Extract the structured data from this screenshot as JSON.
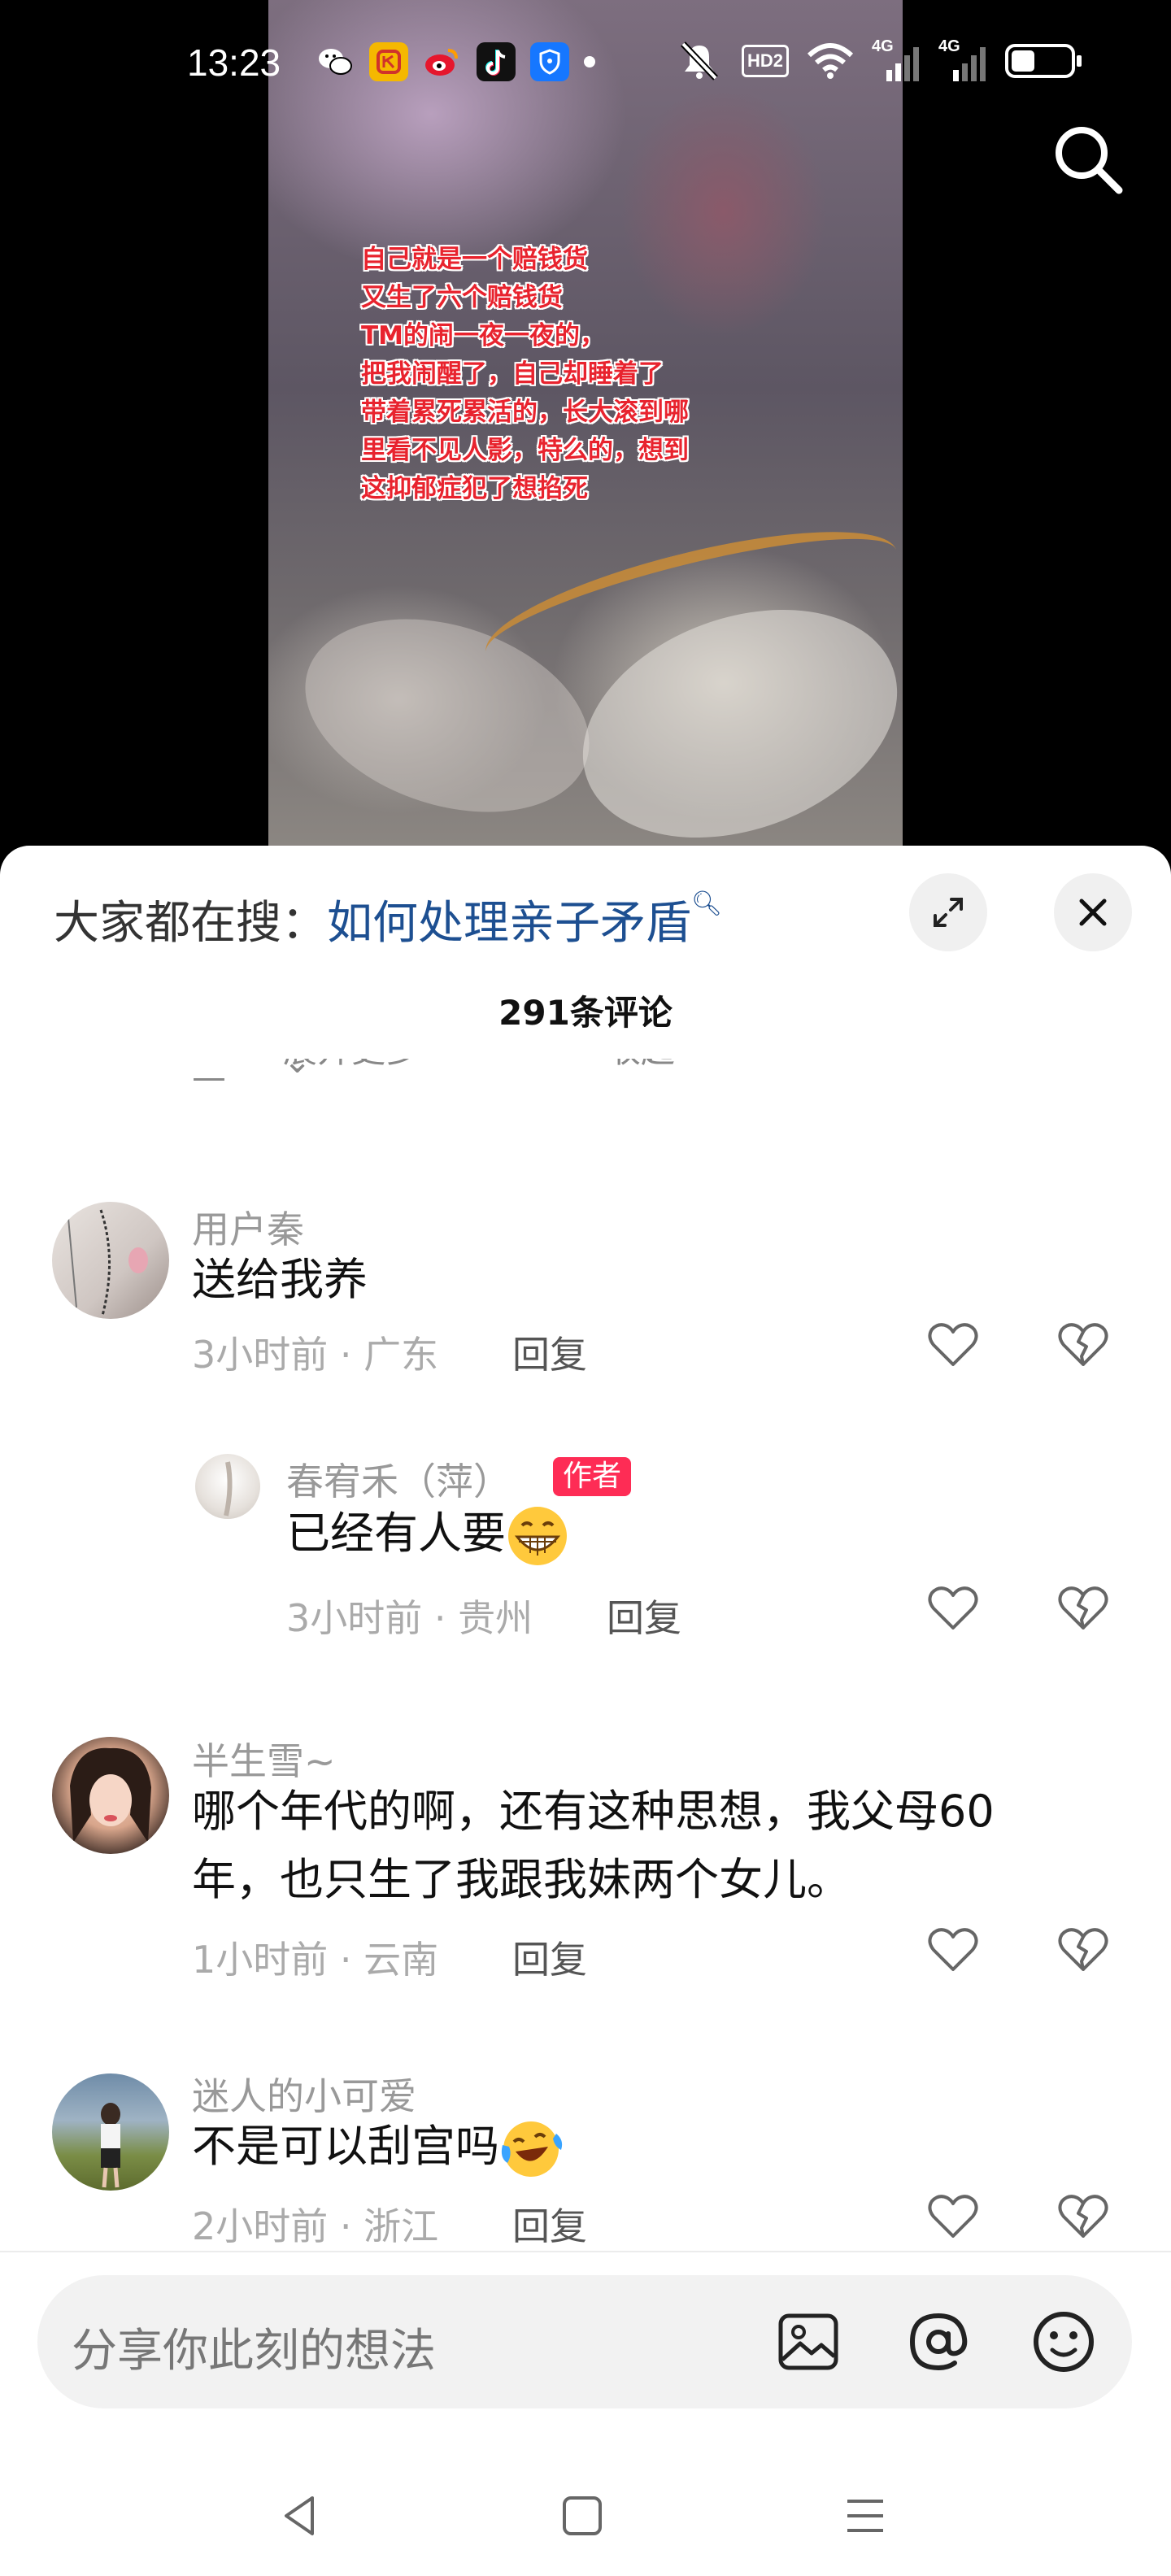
{
  "status_bar": {
    "time": "13:23",
    "hd_label": "HD2",
    "network_1": "4G",
    "network_2": "4G",
    "battery_percent": 40
  },
  "video": {
    "overlay_lines": [
      "自己就是一个赔钱货",
      "又生了六个赔钱货",
      "TM的闹一夜一夜的，",
      "把我闹醒了，自己却睡着了",
      "带着累死累活的，长大滚到哪",
      "里看不见人影，特么的，想到",
      "这抑郁症犯了想掐死"
    ]
  },
  "sheet": {
    "hot_search_prefix": "大家都在搜：",
    "hot_search_term": "如何处理亲子矛盾",
    "comment_count": "291条评论",
    "expand_more": "展开更多",
    "collapse": "收起"
  },
  "comments": [
    {
      "username": "用户秦",
      "text": "送给我养",
      "meta": "3小时前 · 广东",
      "reply_label": "回复"
    },
    {
      "username": "春宥禾（萍）",
      "badge": "作者",
      "text": "已经有人要",
      "meta": "3小时前 · 贵州",
      "reply_label": "回复"
    },
    {
      "username": "半生雪~",
      "text_line1": "哪个年代的啊，还有这种思想，我父母60",
      "text_line2": "年，也只生了我跟我妹两个女儿。",
      "meta": "1小时前 · 云南",
      "reply_label": "回复"
    },
    {
      "username": "迷人的小可爱",
      "text": "不是可以刮宫吗",
      "meta": "2小时前 · 浙江",
      "reply_label": "回复"
    }
  ],
  "input": {
    "placeholder": "分享你此刻的想法"
  },
  "colors": {
    "accent_link": "#1d4f91",
    "author_badge": "#fe2c55",
    "overlay_text": "#e8232e"
  }
}
